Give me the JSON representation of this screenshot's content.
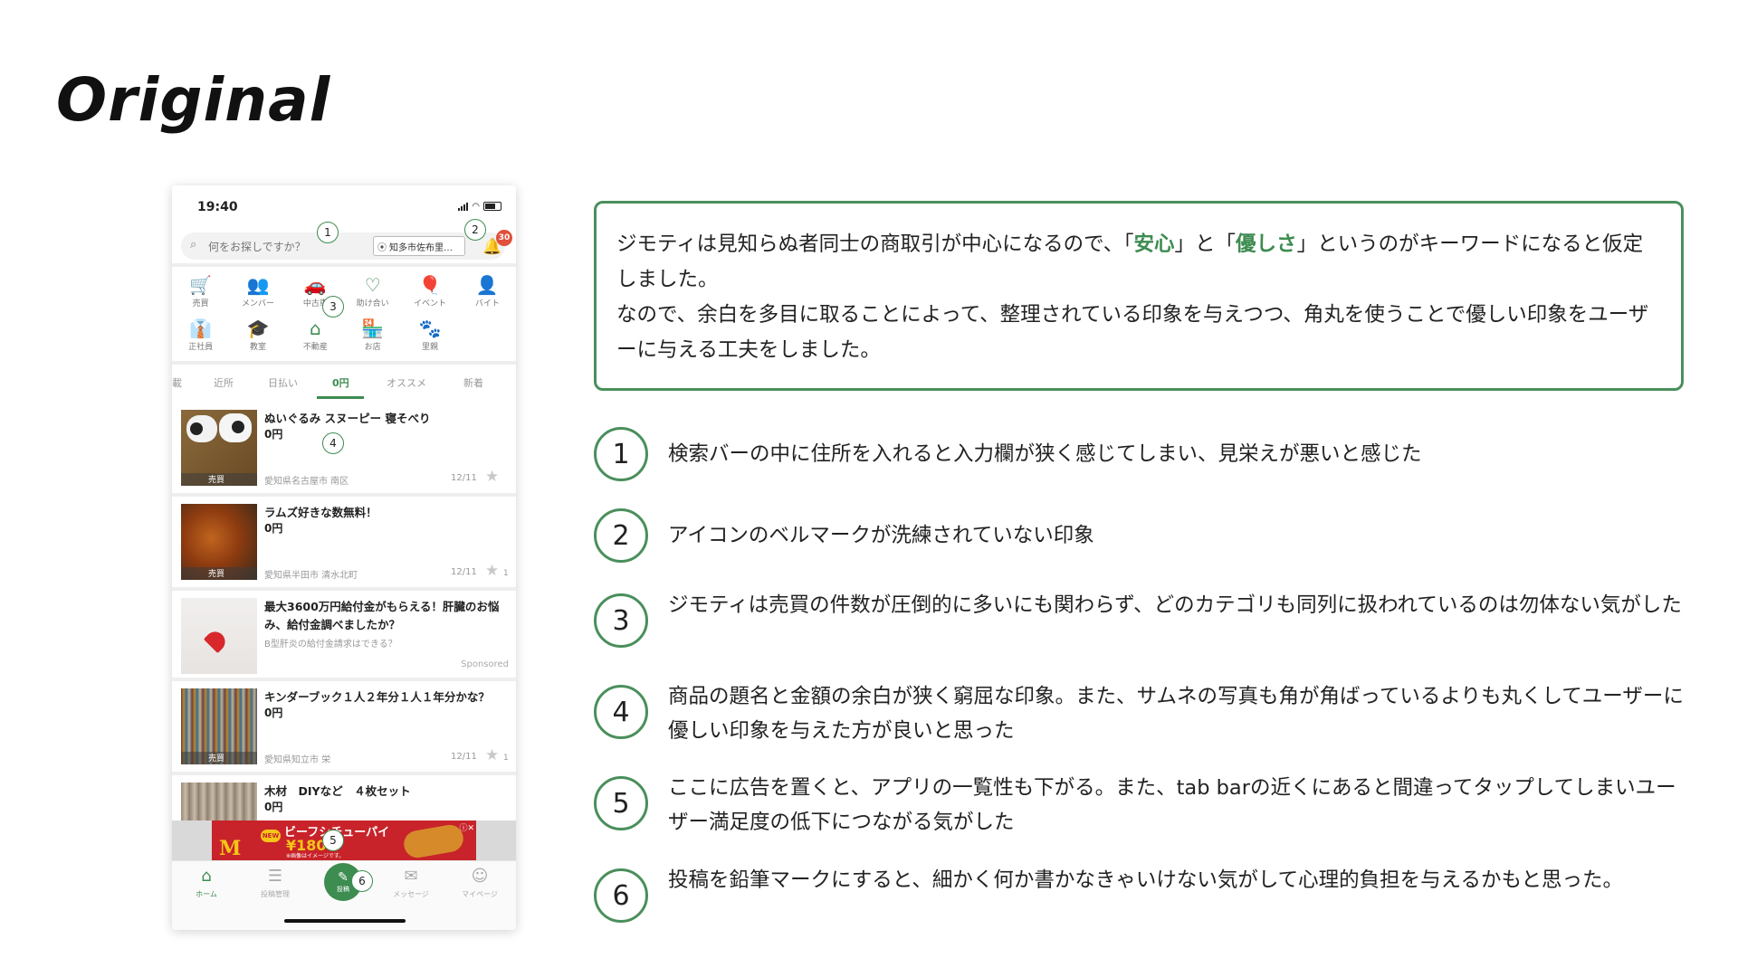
{
  "slide": {
    "title": "Original"
  },
  "phone": {
    "time": "19:40",
    "search": {
      "placeholder": "何をお探しですか？",
      "location": "知多市佐布里…"
    },
    "notification_count": "30",
    "categories": [
      {
        "icon": "cart-icon",
        "glyph": "🛒",
        "label": "売買"
      },
      {
        "icon": "members-icon",
        "glyph": "👥",
        "label": "メンバー"
      },
      {
        "icon": "car-icon",
        "glyph": "🚗",
        "label": "中古車"
      },
      {
        "icon": "heart-hands-icon",
        "glyph": "♡",
        "label": "助け合い"
      },
      {
        "icon": "balloon-icon",
        "glyph": "🎈",
        "label": "イベント"
      },
      {
        "icon": "worker-icon",
        "glyph": "👤",
        "label": "バイト"
      },
      {
        "icon": "employee-icon",
        "glyph": "👔",
        "label": "正社員"
      },
      {
        "icon": "classroom-icon",
        "glyph": "🎓",
        "label": "教室"
      },
      {
        "icon": "house-icon",
        "glyph": "⌂",
        "label": "不動産"
      },
      {
        "icon": "shop-icon",
        "glyph": "🏪",
        "label": "お店"
      },
      {
        "icon": "paw-icon",
        "glyph": "🐾",
        "label": "里親"
      }
    ],
    "tabs": [
      "載",
      "近所",
      "日払い",
      "0円",
      "オススメ",
      "新着"
    ],
    "active_tab": "0円",
    "listings": [
      {
        "title": "ぬいぐるみ スヌーピー 寝そべり",
        "price": "0円",
        "location": "愛知県名古屋市 南区",
        "date": "12/11",
        "stars": "",
        "tag": "売買"
      },
      {
        "title": "ラムズ好きな数無料！",
        "price": "0円",
        "location": "愛知県半田市 清水北町",
        "date": "12/11",
        "stars": "1",
        "tag": "売買"
      },
      {
        "title": "キンダーブック１人２年分１人１年分かな？",
        "price": "0円",
        "location": "愛知県知立市 栄",
        "date": "12/11",
        "stars": "1",
        "tag": "売買"
      },
      {
        "title": "木材　DIYなど　４枚セット",
        "price": "0円"
      }
    ],
    "sponsored_item": {
      "title": "最大3600万円給付金がもらえる！肝臓のお悩み、給付金調べましたか？",
      "subtitle": "B型肝炎の給付金請求はできる？",
      "label": "Sponsored"
    },
    "banner_ad": {
      "badge": "NEW",
      "headline": "ビーフシチューパイ",
      "price": "¥180",
      "note": "※画像はイメージです。",
      "close": "ⓘ✕"
    },
    "tabbar": [
      {
        "label": "ホーム",
        "active": true
      },
      {
        "label": "投稿管理"
      },
      {
        "label": "投稿"
      },
      {
        "label": "メッセージ"
      },
      {
        "label": "マイページ"
      }
    ],
    "markers": [
      "1",
      "2",
      "3",
      "4",
      "5",
      "6"
    ]
  },
  "intro": {
    "line1_a": "ジモティは見知らぬ者同士の商取引が中心になるので、「",
    "kw1": "安心",
    "line1_b": "」と「",
    "kw2": "優しさ",
    "line1_c": "」というのがキーワードになると仮定しました。",
    "line2": "なので、余白を多目に取ることによって、整理されている印象を与えつつ、角丸を使うことで優しい印象をユーザーに与える工夫をしました。"
  },
  "points": [
    {
      "num": "1",
      "text": "検索バーの中に住所を入れると入力欄が狭く感じてしまい、見栄えが悪いと感じた"
    },
    {
      "num": "2",
      "text": "アイコンのベルマークが洗練されていない印象"
    },
    {
      "num": "3",
      "text": "ジモティは売買の件数が圧倒的に多いにも関わらず、どのカテゴリも同列に扱われているのは勿体ない気がした"
    },
    {
      "num": "4",
      "text": "商品の題名と金額の余白が狭く窮屈な印象。また、サムネの写真も角が角ばっているよりも丸くしてユーザーに優しい印象を与えた方が良いと思った"
    },
    {
      "num": "5",
      "text": "ここに広告を置くと、アプリの一覧性も下がる。また、tab barの近くにあると間違ってタップしてしまいユーザー満足度の低下につながる気がした"
    },
    {
      "num": "6",
      "text": "投稿を鉛筆マークにすると、細かく何か書かなきゃいけない気がして心理的負担を与えるかもと思った。"
    }
  ],
  "colors": {
    "accent": "#3d8c50",
    "frame": "#4a8f5c",
    "badge": "#e0503a"
  }
}
